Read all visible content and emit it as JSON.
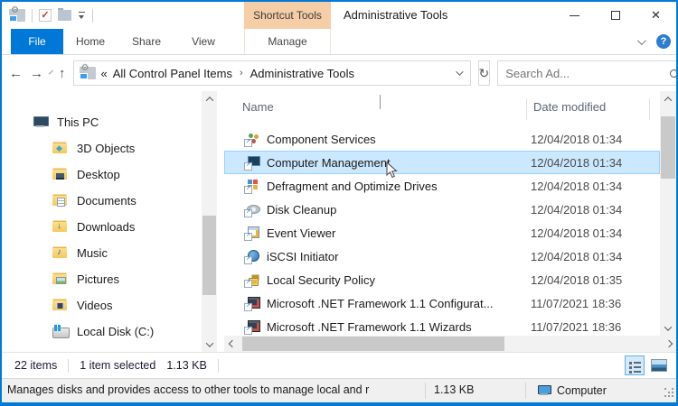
{
  "window": {
    "title": "Administrative Tools"
  },
  "colors": {
    "accent": "#0078d7",
    "contextual_tab": "#f5cda6",
    "selection_bg": "#cce8ff",
    "selection_border": "#99d1ff"
  },
  "icons": {
    "back": "←",
    "forward": "→",
    "up": "↑",
    "refresh": "↻",
    "close": "✕",
    "help": "?"
  },
  "qat": {
    "icons": [
      "system-folder-gears-icon",
      "red-check-icon",
      "folder-icon",
      "customize-dropdown-icon"
    ]
  },
  "ribbon": {
    "contextual_group": "Shortcut Tools",
    "tabs": [
      {
        "label": "File",
        "class": "active"
      },
      {
        "label": "Home"
      },
      {
        "label": "Share"
      },
      {
        "label": "View"
      },
      {
        "label": "Manage",
        "class": "contextual"
      }
    ]
  },
  "addressbar": {
    "overflow": "«",
    "separator": "›",
    "crumbs": [
      "All Control Panel Items",
      "Administrative Tools"
    ],
    "search_text": "Search Ad..."
  },
  "sidebar": {
    "items": [
      {
        "label": "This PC",
        "icon": "this-pc",
        "level": 0
      },
      {
        "label": "3D Objects",
        "icon": "folder-3d",
        "level": 1
      },
      {
        "label": "Desktop",
        "icon": "folder-desktop",
        "level": 1
      },
      {
        "label": "Documents",
        "icon": "folder-documents",
        "level": 1
      },
      {
        "label": "Downloads",
        "icon": "folder-downloads",
        "level": 1
      },
      {
        "label": "Music",
        "icon": "folder-music",
        "level": 1
      },
      {
        "label": "Pictures",
        "icon": "folder-pictures",
        "level": 1
      },
      {
        "label": "Videos",
        "icon": "folder-videos",
        "level": 1
      },
      {
        "label": "Local Disk (C:)",
        "icon": "local-disk",
        "level": 1
      }
    ]
  },
  "files": {
    "columns": [
      "Name",
      "Date modified"
    ],
    "rows": [
      {
        "name": "Component Services",
        "date": "12/04/2018 01:34",
        "icon": "component-services"
      },
      {
        "name": "Computer Management",
        "date": "12/04/2018 01:34",
        "icon": "computer-management",
        "selected": true
      },
      {
        "name": "Defragment and Optimize Drives",
        "date": "12/04/2018 01:34",
        "icon": "defrag"
      },
      {
        "name": "Disk Cleanup",
        "date": "12/04/2018 01:34",
        "icon": "disk-cleanup"
      },
      {
        "name": "Event Viewer",
        "date": "12/04/2018 01:34",
        "icon": "event-viewer"
      },
      {
        "name": "iSCSI Initiator",
        "date": "12/04/2018 01:34",
        "icon": "iscsi"
      },
      {
        "name": "Local Security Policy",
        "date": "12/04/2018 01:35",
        "icon": "security-policy"
      },
      {
        "name": "Microsoft .NET Framework 1.1 Configurat...",
        "date": "11/07/2021 18:36",
        "icon": "dotnet"
      },
      {
        "name": "Microsoft .NET Framework 1.1 Wizards",
        "date": "11/07/2021 18:36",
        "icon": "dotnet"
      }
    ]
  },
  "statusbar": {
    "items_count": "22 items",
    "selection": "1 item selected",
    "selection_size": "1.13 KB"
  },
  "bottombar": {
    "description": "Manages disks and provides access to other tools to manage local and r",
    "size": "1.13 KB",
    "location": "Computer"
  }
}
